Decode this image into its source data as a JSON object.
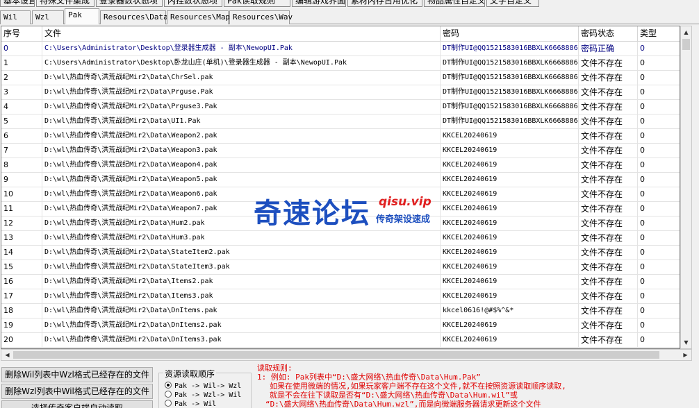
{
  "top_tabs": [
    "基本设置",
    "特殊文件集成",
    "登录器数状态项",
    "内挂数状态项",
    "Pak读取规则",
    "编辑游戏界面UI",
    "素材内存占用优化",
    "物品属性自定义",
    "文字自定义"
  ],
  "sub_tabs": [
    "Wil",
    "Wzl",
    "Pak",
    "Resources\\Data",
    "Resources\\Map",
    "Resources\\Wav"
  ],
  "columns": [
    "序号",
    "文件",
    "密码",
    "密码状态",
    "类型"
  ],
  "rows": [
    {
      "idx": "0",
      "file": "C:\\Users\\Administrator\\Desktop\\登录器生成器 - 副本\\NewopUI.Pak",
      "pwd": "DT制作UI@QQ1521583016BBXLK6668886",
      "status": "密码正确",
      "type": "0"
    },
    {
      "idx": "1",
      "file": "C:\\Users\\Administrator\\Desktop\\卧龙山庄(单机)\\登录器生成器 - 副本\\NewopUI.Pak",
      "pwd": "DT制作UI@QQ1521583016BBXLK6668886",
      "status": "文件不存在",
      "type": "0"
    },
    {
      "idx": "2",
      "file": "D:\\wl\\热血传奇\\洪荒战纪Mir2\\Data\\ChrSel.pak",
      "pwd": "DT制作UI@QQ1521583016BBXLK6668886",
      "status": "文件不存在",
      "type": "0"
    },
    {
      "idx": "3",
      "file": "D:\\wl\\热血传奇\\洪荒战纪Mir2\\Data\\Prguse.Pak",
      "pwd": "DT制作UI@QQ1521583016BBXLK6668886",
      "status": "文件不存在",
      "type": "0"
    },
    {
      "idx": "4",
      "file": "D:\\wl\\热血传奇\\洪荒战纪Mir2\\Data\\Prguse3.Pak",
      "pwd": "DT制作UI@QQ1521583016BBXLK6668886",
      "status": "文件不存在",
      "type": "0"
    },
    {
      "idx": "5",
      "file": "D:\\wl\\热血传奇\\洪荒战纪Mir2\\Data\\UI1.Pak",
      "pwd": "DT制作UI@QQ1521583016BBXLK6668886",
      "status": "文件不存在",
      "type": "0"
    },
    {
      "idx": "6",
      "file": "D:\\wl\\热血传奇\\洪荒战纪Mir2\\Data\\Weapon2.pak",
      "pwd": "KKCEL20240619",
      "status": "文件不存在",
      "type": "0"
    },
    {
      "idx": "7",
      "file": "D:\\wl\\热血传奇\\洪荒战纪Mir2\\Data\\Weapon3.pak",
      "pwd": "KKCEL20240619",
      "status": "文件不存在",
      "type": "0"
    },
    {
      "idx": "8",
      "file": "D:\\wl\\热血传奇\\洪荒战纪Mir2\\Data\\Weapon4.pak",
      "pwd": "KKCEL20240619",
      "status": "文件不存在",
      "type": "0"
    },
    {
      "idx": "9",
      "file": "D:\\wl\\热血传奇\\洪荒战纪Mir2\\Data\\Weapon5.pak",
      "pwd": "KKCEL20240619",
      "status": "文件不存在",
      "type": "0"
    },
    {
      "idx": "10",
      "file": "D:\\wl\\热血传奇\\洪荒战纪Mir2\\Data\\Weapon6.pak",
      "pwd": "KKCEL20240619",
      "status": "文件不存在",
      "type": "0"
    },
    {
      "idx": "11",
      "file": "D:\\wl\\热血传奇\\洪荒战纪Mir2\\Data\\Weapon7.pak",
      "pwd": "KKCEL20240619",
      "status": "文件不存在",
      "type": "0"
    },
    {
      "idx": "12",
      "file": "D:\\wl\\热血传奇\\洪荒战纪Mir2\\Data\\Hum2.pak",
      "pwd": "KKCEL20240619",
      "status": "文件不存在",
      "type": "0"
    },
    {
      "idx": "13",
      "file": "D:\\wl\\热血传奇\\洪荒战纪Mir2\\Data\\Hum3.pak",
      "pwd": "KKCEL20240619",
      "status": "文件不存在",
      "type": "0"
    },
    {
      "idx": "14",
      "file": "D:\\wl\\热血传奇\\洪荒战纪Mir2\\Data\\StateItem2.pak",
      "pwd": "KKCEL20240619",
      "status": "文件不存在",
      "type": "0"
    },
    {
      "idx": "15",
      "file": "D:\\wl\\热血传奇\\洪荒战纪Mir2\\Data\\StateItem3.pak",
      "pwd": "KKCEL20240619",
      "status": "文件不存在",
      "type": "0"
    },
    {
      "idx": "16",
      "file": "D:\\wl\\热血传奇\\洪荒战纪Mir2\\Data\\Items2.pak",
      "pwd": "KKCEL20240619",
      "status": "文件不存在",
      "type": "0"
    },
    {
      "idx": "17",
      "file": "D:\\wl\\热血传奇\\洪荒战纪Mir2\\Data\\Items3.pak",
      "pwd": "KKCEL20240619",
      "status": "文件不存在",
      "type": "0"
    },
    {
      "idx": "18",
      "file": "D:\\wl\\热血传奇\\洪荒战纪Mir2\\Data\\DnItems.pak",
      "pwd": "kkcel0616!@#$%^&*",
      "status": "文件不存在",
      "type": "0"
    },
    {
      "idx": "19",
      "file": "D:\\wl\\热血传奇\\洪荒战纪Mir2\\Data\\DnItems2.pak",
      "pwd": "KKCEL20240619",
      "status": "文件不存在",
      "type": "0"
    },
    {
      "idx": "20",
      "file": "D:\\wl\\热血传奇\\洪荒战纪Mir2\\Data\\DnItems3.pak",
      "pwd": "KKCEL20240619",
      "status": "文件不存在",
      "type": "0"
    }
  ],
  "buttons": {
    "delete_wil": "删除Wil列表中Wzl格式已经存在的文件",
    "delete_wzl": "删除Wzl列表中Wil格式已经存在的文件",
    "select_file": "选择传奇客户端自动读取"
  },
  "read_order": {
    "legend": "资源读取顺序",
    "options": [
      "Pak -> Wil-> Wzl",
      "Pak -> Wzl-> Wil",
      "Pak -> Wil"
    ],
    "selected": 0
  },
  "rules": {
    "title": "读取规则:",
    "lines": [
      "1: 例如: Pak列表中“D:\\盛大网络\\热血传奇\\Data\\Hum.Pak”",
      "如果在使用微端的情况,如果玩家客户端不存在这个文件,就不在按照资源读取顺序读取,",
      "就是不会在往下读取是否有“D:\\盛大网络\\热血传奇\\Data\\Hum.wil”或",
      "“D:\\盛大网络\\热血传奇\\Data\\Hum.wzl”,而是向微端服务器请求更新这个文件"
    ]
  },
  "watermark": {
    "title": "奇速论坛",
    "url": "qisu.vip",
    "subtitle": "传奇架设速成"
  },
  "colors": {
    "selected_text": "#000080",
    "rules_text": "#e00000",
    "watermark_blue": "#1d4fbf",
    "watermark_red": "#e02020"
  }
}
